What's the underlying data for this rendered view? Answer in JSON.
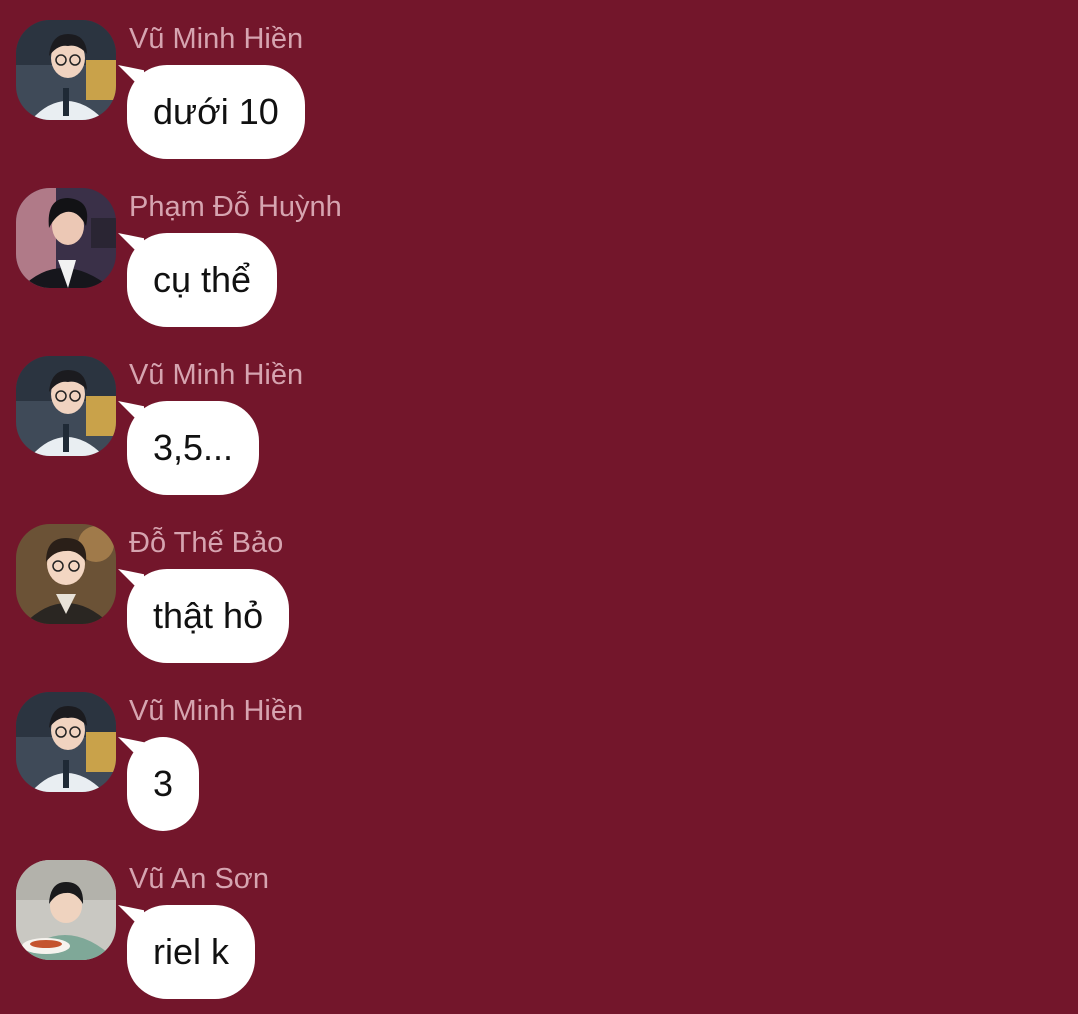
{
  "theme": {
    "background": "#73162b",
    "sender_color": "#d6a4b0",
    "bubble_color": "#ffffff",
    "text_color": "#111111"
  },
  "messages": [
    {
      "sender": "Vũ Minh Hiền",
      "text": "dưới 10",
      "avatar": "avatar-vu-minh-hien"
    },
    {
      "sender": "Phạm Đỗ Huỳnh",
      "text": "cụ thể",
      "avatar": "avatar-pham-do-huynh"
    },
    {
      "sender": "Vũ Minh Hiền",
      "text": "3,5...",
      "avatar": "avatar-vu-minh-hien"
    },
    {
      "sender": "Đỗ Thế Bảo",
      "text": "thật hỏ",
      "avatar": "avatar-do-the-bao"
    },
    {
      "sender": "Vũ Minh Hiền",
      "text": "3",
      "avatar": "avatar-vu-minh-hien"
    },
    {
      "sender": "Vũ An Sơn",
      "text": "riel k",
      "avatar": "avatar-vu-an-son"
    }
  ]
}
